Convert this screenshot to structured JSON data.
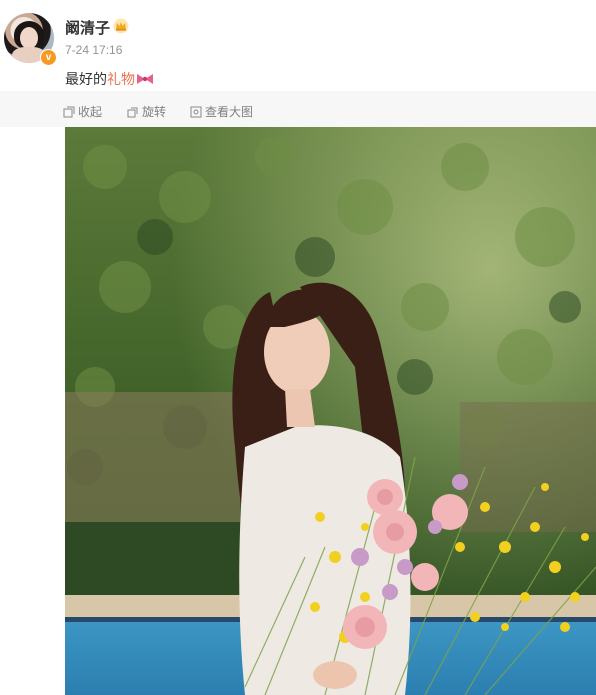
{
  "post": {
    "username": "阚清子",
    "timestamp": "7-24 17:16",
    "text_prefix": "最好的",
    "text_link": "礼物",
    "verified_badge": "v"
  },
  "toolbar": {
    "collapse_label": "收起",
    "rotate_label": "旋转",
    "view_large_label": "查看大图"
  },
  "icons": {
    "crown": "crown-icon",
    "bow": "bow-emoji-icon",
    "collapse": "collapse-icon",
    "rotate": "rotate-icon",
    "view_large": "view-large-icon"
  },
  "colors": {
    "link": "#eb7350",
    "badge": "#f59a23",
    "meta": "#939393",
    "toolbar_bg": "#f7f7f7"
  }
}
